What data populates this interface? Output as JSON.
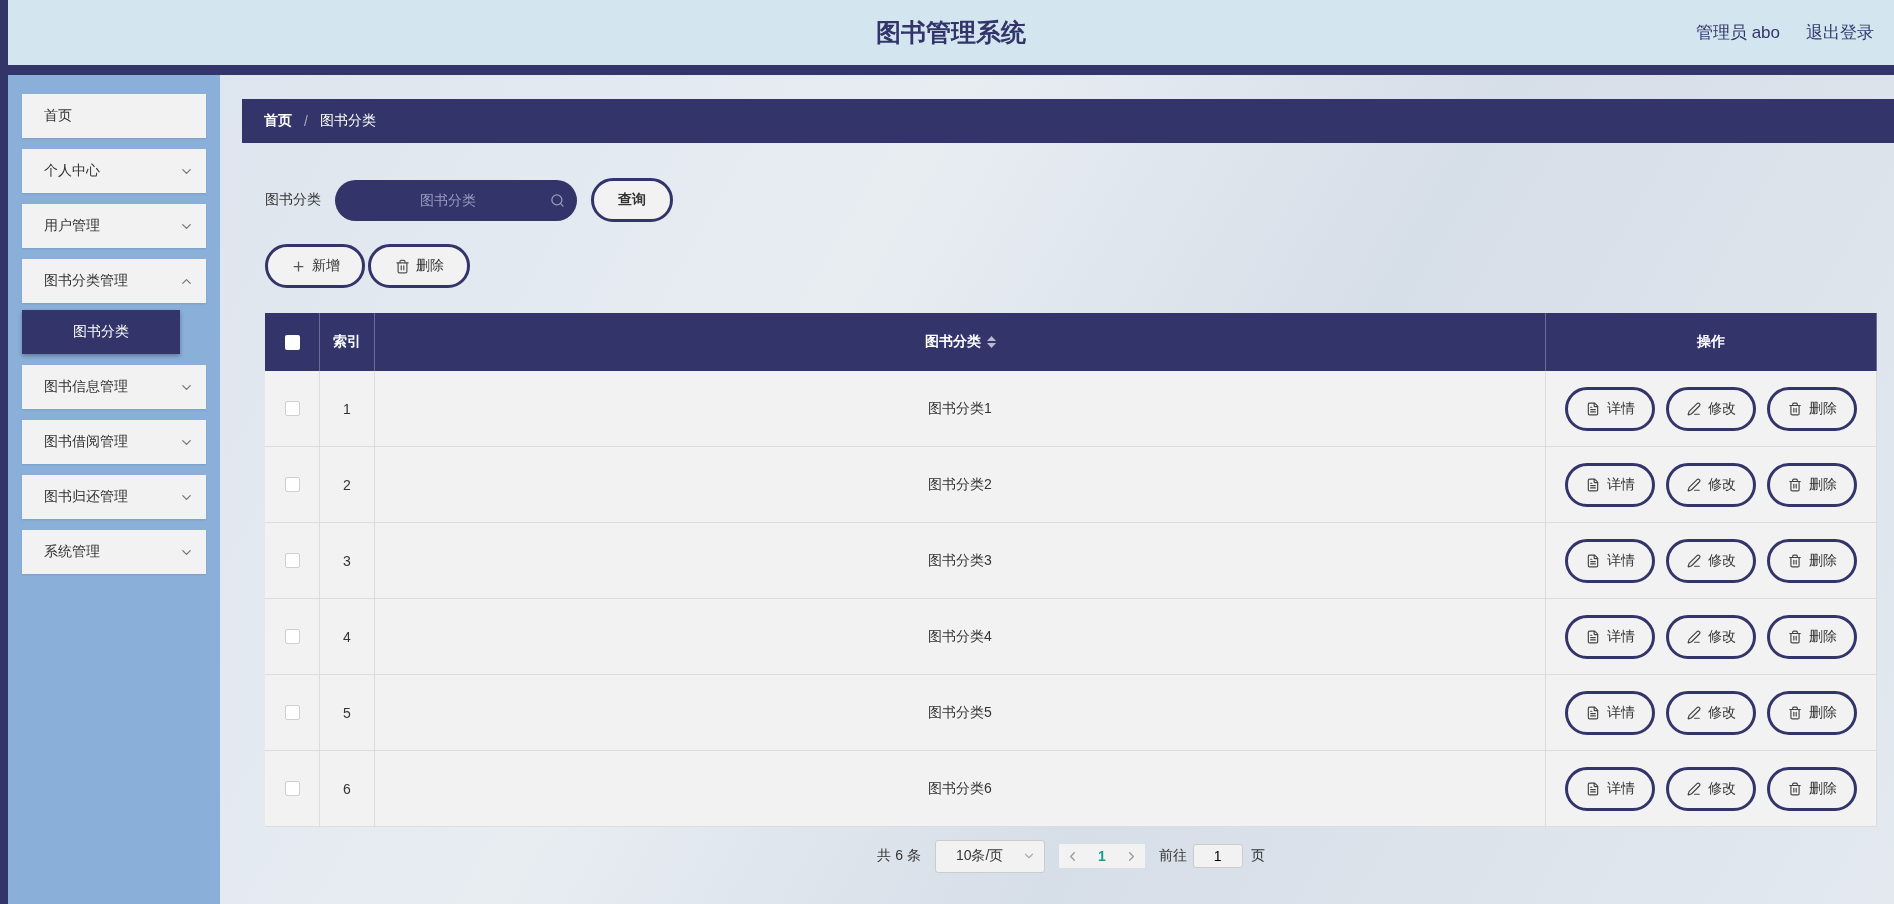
{
  "header": {
    "title": "图书管理系统",
    "user": "管理员 abo",
    "logout": "退出登录"
  },
  "sidebar": {
    "items": [
      {
        "kind": "link",
        "label": "首页",
        "selected": false
      },
      {
        "kind": "group",
        "label": "个人中心",
        "expanded": false
      },
      {
        "kind": "group",
        "label": "用户管理",
        "expanded": false
      },
      {
        "kind": "group",
        "label": "图书分类管理",
        "expanded": true,
        "children": [
          {
            "label": "图书分类",
            "selected": true
          }
        ]
      },
      {
        "kind": "group",
        "label": "图书信息管理",
        "expanded": false
      },
      {
        "kind": "group",
        "label": "图书借阅管理",
        "expanded": false
      },
      {
        "kind": "group",
        "label": "图书归还管理",
        "expanded": false
      },
      {
        "kind": "group",
        "label": "系统管理",
        "expanded": false
      }
    ]
  },
  "breadcrumb": {
    "items": [
      "首页",
      "图书分类"
    ],
    "separator": "/"
  },
  "search": {
    "label": "图书分类",
    "placeholder": "图书分类",
    "button": "查询"
  },
  "toolbar": [
    {
      "kind": "add",
      "label": "新增"
    },
    {
      "kind": "delete",
      "label": "删除"
    }
  ],
  "table": {
    "select_all_checked": false,
    "columns": [
      {
        "label": "索引",
        "sortable": false
      },
      {
        "label": "图书分类",
        "sortable": true
      },
      {
        "label": "操作",
        "sortable": false
      }
    ],
    "rows": [
      {
        "checked": false,
        "index": "1",
        "name": "图书分类1",
        "actions": [
          {
            "kind": "detail",
            "label": "详情"
          },
          {
            "kind": "edit",
            "label": "修改"
          },
          {
            "kind": "delete",
            "label": "删除"
          }
        ]
      },
      {
        "checked": false,
        "index": "2",
        "name": "图书分类2",
        "actions": [
          {
            "kind": "detail",
            "label": "详情"
          },
          {
            "kind": "edit",
            "label": "修改"
          },
          {
            "kind": "delete",
            "label": "删除"
          }
        ]
      },
      {
        "checked": false,
        "index": "3",
        "name": "图书分类3",
        "actions": [
          {
            "kind": "detail",
            "label": "详情"
          },
          {
            "kind": "edit",
            "label": "修改"
          },
          {
            "kind": "delete",
            "label": "删除"
          }
        ]
      },
      {
        "checked": false,
        "index": "4",
        "name": "图书分类4",
        "actions": [
          {
            "kind": "detail",
            "label": "详情"
          },
          {
            "kind": "edit",
            "label": "修改"
          },
          {
            "kind": "delete",
            "label": "删除"
          }
        ]
      },
      {
        "checked": false,
        "index": "5",
        "name": "图书分类5",
        "actions": [
          {
            "kind": "detail",
            "label": "详情"
          },
          {
            "kind": "edit",
            "label": "修改"
          },
          {
            "kind": "delete",
            "label": "删除"
          }
        ]
      },
      {
        "checked": false,
        "index": "6",
        "name": "图书分类6",
        "actions": [
          {
            "kind": "detail",
            "label": "详情"
          },
          {
            "kind": "edit",
            "label": "修改"
          },
          {
            "kind": "delete",
            "label": "删除"
          }
        ]
      }
    ]
  },
  "pagination": {
    "total": "共 6 条",
    "page_size": "10条/页",
    "pages": [
      {
        "label": "1",
        "selected": true
      }
    ],
    "goto_label": "前往",
    "goto_value": "1",
    "goto_suffix": "页"
  }
}
